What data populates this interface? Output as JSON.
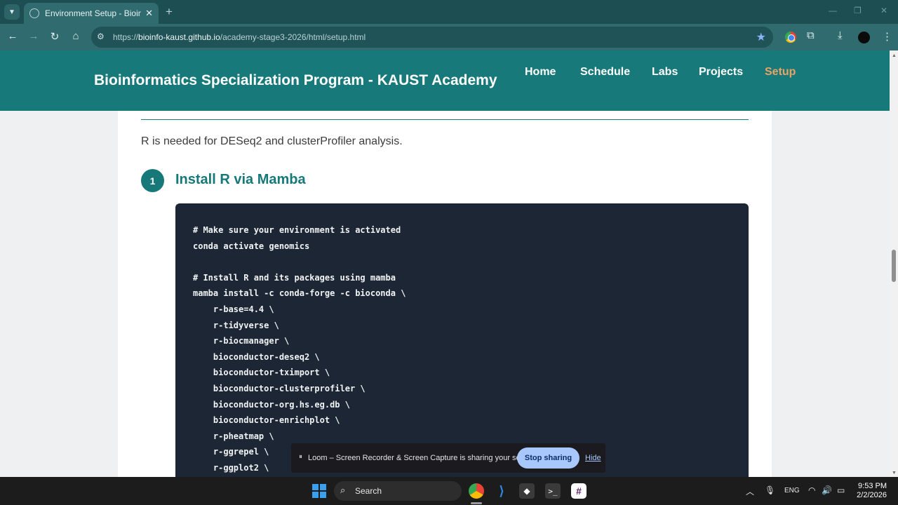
{
  "browser": {
    "tab_title": "Environment Setup - Bioinform",
    "tab_close": "✕",
    "new_tab": "+",
    "url_scheme": "https://",
    "url_host": "bioinfo-kaust.github.io",
    "url_path": "/academy-stage3-2026/html/setup.html"
  },
  "site": {
    "brand": "Bioinformatics Specialization Program - KAUST Academy",
    "nav": [
      "Home",
      "Schedule",
      "Labs",
      "Projects",
      "Setup"
    ],
    "active_nav": "Setup",
    "accent_color": "#18797a",
    "active_color": "#e8a464"
  },
  "content": {
    "intro": "R is needed for DESeq2 and clusterProfiler analysis.",
    "step_number": "1",
    "step_title": "Install R via Mamba",
    "code_lines": [
      "# Make sure your environment is activated",
      "conda activate genomics",
      "",
      "# Install R and its packages using mamba",
      "mamba install -c conda-forge -c bioconda \\",
      "    r-base=4.4 \\",
      "    r-tidyverse \\",
      "    r-biocmanager \\",
      "    bioconductor-deseq2 \\",
      "    bioconductor-tximport \\",
      "    bioconductor-clusterprofiler \\",
      "    bioconductor-org.hs.eg.db \\",
      "    bioconductor-enrichplot \\",
      "    r-pheatmap \\",
      "    r-ggrepel \\",
      "    r-ggplot2 \\"
    ]
  },
  "loom": {
    "message": "Loom – Screen Recorder & Screen Capture is sharing your screen.",
    "stop_label": "Stop sharing",
    "hide_label": "Hide"
  },
  "taskbar": {
    "search_label": "Search",
    "language": "ENG",
    "time": "9:53 PM",
    "date": "2/2/2026"
  }
}
